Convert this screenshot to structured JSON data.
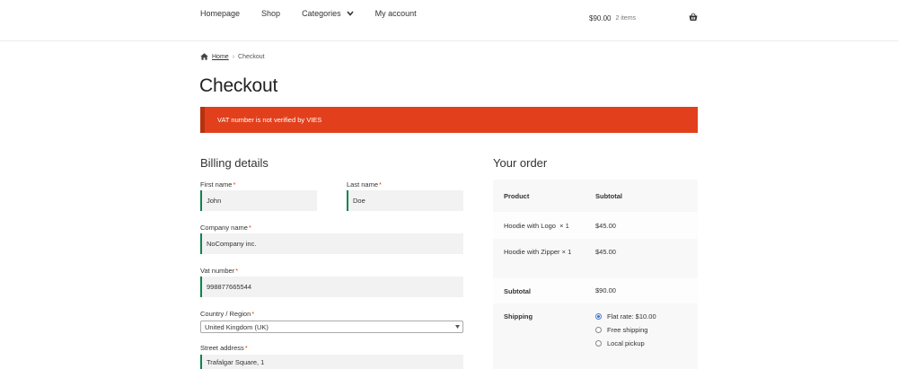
{
  "nav": {
    "items": [
      "Homepage",
      "Shop",
      "Categories",
      "My account"
    ]
  },
  "cart": {
    "total": "$90.00",
    "count": "2 items"
  },
  "breadcrumb": {
    "home": "Home",
    "current": "Checkout"
  },
  "page": {
    "title": "Checkout"
  },
  "notice": {
    "message": "VAT number is not verified by VIES"
  },
  "billing": {
    "title": "Billing details",
    "required_mark": "*",
    "first_name": {
      "label": "First name",
      "value": "John"
    },
    "last_name": {
      "label": "Last name",
      "value": "Doe"
    },
    "company": {
      "label": "Company name",
      "value": "NoCompany inc."
    },
    "vat": {
      "label": "Vat number",
      "value": "998877665544"
    },
    "country": {
      "label": "Country / Region",
      "value": "United Kingdom (UK)"
    },
    "street": {
      "label": "Street address",
      "value": "Trafalgar Square, 1"
    }
  },
  "order": {
    "title": "Your order",
    "col_product": "Product",
    "col_subtotal": "Subtotal",
    "items": [
      {
        "name": "Hoodie with Logo",
        "qty": "× 1",
        "price": "$45.00"
      },
      {
        "name": "Hoodie with Zipper",
        "qty": "× 1",
        "price": "$45.00"
      }
    ],
    "subtotal_label": "Subtotal",
    "subtotal_value": "$90.00",
    "shipping_label": "Shipping",
    "shipping_options": [
      {
        "label": "Flat rate: $10.00",
        "selected": true
      },
      {
        "label": "Free shipping",
        "selected": false
      },
      {
        "label": "Local pickup",
        "selected": false
      }
    ]
  },
  "colors": {
    "accent": "#e2401c",
    "valid": "#0f834d",
    "radio": "#2f6fd6"
  }
}
